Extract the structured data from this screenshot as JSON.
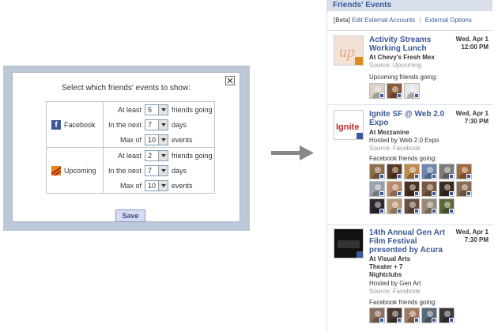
{
  "dialog": {
    "title": "Select which friends' events to show:",
    "save_label": "Save",
    "services": [
      {
        "name": "Facebook",
        "icon": "facebook-icon",
        "rows": [
          {
            "label": "At least",
            "value": "5",
            "suffix": "friends going"
          },
          {
            "label": "In the next",
            "value": "7",
            "suffix": "days"
          },
          {
            "label": "Max of",
            "value": "10",
            "suffix": "events"
          }
        ]
      },
      {
        "name": "Upcoming",
        "icon": "upcoming-icon",
        "rows": [
          {
            "label": "At least",
            "value": "2",
            "suffix": "friends going"
          },
          {
            "label": "In the next",
            "value": "7",
            "suffix": "days"
          },
          {
            "label": "Max of",
            "value": "10",
            "suffix": "events"
          }
        ]
      }
    ]
  },
  "panel": {
    "header": "Friends' Events",
    "beta": "[Beta]",
    "link_accounts": "Edit External Accounts",
    "separator": "|",
    "link_options": "External Options"
  },
  "events": [
    {
      "title": "Activity Streams Working Lunch",
      "date": "Wed, Apr 1",
      "time": "12:00 PM",
      "location": "At Chevy's Fresh Mex",
      "host": "",
      "source": "Source: Upcoming",
      "going_label": "Upcoming friends going:",
      "friend_colors": [
        "#d9d2c4",
        "#8a5a3c",
        "#e6e6e6"
      ]
    },
    {
      "title": "Ignite SF @ Web 2.0 Expo",
      "date": "Wed, Apr 1",
      "time": "7:30 PM",
      "location": "At Mezzanine",
      "host": "Hosted by Web 2.0 Expo",
      "source": "Source: Facebook",
      "going_label": "Facebook friends going:",
      "friend_colors": [
        "#8d6e4a",
        "#5a3a22",
        "#c08a4a",
        "#6c86b0",
        "#7a7a7a",
        "#a06a3c",
        "#9aa2ac",
        "#b88a6a",
        "#4a3020",
        "#7a5a40",
        "#3a2a20",
        "#8a6a50",
        "#2e2a30",
        "#b89a7a",
        "#6a5040",
        "#9a8a7a",
        "#5a6a3a"
      ]
    },
    {
      "title": "14th Annual Gen Art Film Festival presented by Acura",
      "date": "Wed, Apr 1",
      "time": "7:30 PM",
      "location": "At Visual Arts Theater + 7 Nightclubs",
      "host": "Hosted by Gen Art",
      "source": "Source: Facebook",
      "going_label": "Facebook friends going:",
      "friend_colors": [
        "#8a7060",
        "#4a3a30",
        "#a07a60",
        "#5a6a7a",
        "#3a3a3a"
      ]
    }
  ]
}
